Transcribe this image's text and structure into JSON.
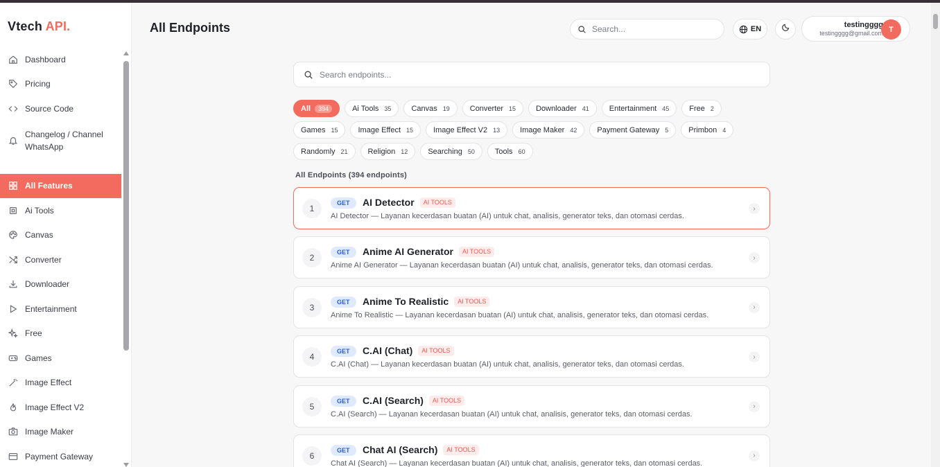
{
  "brand": {
    "part1": "Vtech",
    "part2": "API."
  },
  "sidebar": {
    "top_items": [
      {
        "label": "Dashboard",
        "icon": "home-icon"
      },
      {
        "label": "Pricing",
        "icon": "tag-icon"
      },
      {
        "label": "Source Code",
        "icon": "code-icon"
      },
      {
        "label": "Changelog / Channel WhatsApp",
        "icon": "bell-icon"
      }
    ],
    "feature_items": [
      {
        "label": "All Features",
        "icon": "grid-icon",
        "active": true
      },
      {
        "label": "Ai Tools",
        "icon": "chip-icon"
      },
      {
        "label": "Canvas",
        "icon": "palette-icon"
      },
      {
        "label": "Converter",
        "icon": "shuffle-icon"
      },
      {
        "label": "Downloader",
        "icon": "download-icon"
      },
      {
        "label": "Entertainment",
        "icon": "play-icon"
      },
      {
        "label": "Free",
        "icon": "sparkle-icon"
      },
      {
        "label": "Games",
        "icon": "gamepad-icon"
      },
      {
        "label": "Image Effect",
        "icon": "wand-icon"
      },
      {
        "label": "Image Effect V2",
        "icon": "flame-icon"
      },
      {
        "label": "Image Maker",
        "icon": "camera-icon"
      },
      {
        "label": "Payment Gateway",
        "icon": "card-icon"
      }
    ]
  },
  "header": {
    "title": "All Endpoints",
    "search_placeholder": "Search...",
    "lang": "EN",
    "user_name": "testingggg",
    "user_email": "testingggg@gmail.com",
    "avatar_letter": "T"
  },
  "main": {
    "search_placeholder": "Search endpoints...",
    "list_title": "All Endpoints (394 endpoints)",
    "chip_rows": [
      [
        {
          "label": "All",
          "count": "394",
          "active": true
        },
        {
          "label": "Ai Tools",
          "count": "35"
        },
        {
          "label": "Canvas",
          "count": "19"
        },
        {
          "label": "Converter",
          "count": "15"
        },
        {
          "label": "Downloader",
          "count": "41"
        },
        {
          "label": "Entertainment",
          "count": "45"
        },
        {
          "label": "Free",
          "count": "2"
        }
      ],
      [
        {
          "label": "Games",
          "count": "15"
        },
        {
          "label": "Image Effect",
          "count": "15"
        },
        {
          "label": "Image Effect V2",
          "count": "13"
        },
        {
          "label": "Image Maker",
          "count": "42"
        },
        {
          "label": "Payment Gateway",
          "count": "5"
        },
        {
          "label": "Primbon",
          "count": "4"
        }
      ],
      [
        {
          "label": "Randomly",
          "count": "21"
        },
        {
          "label": "Religion",
          "count": "12"
        },
        {
          "label": "Searching",
          "count": "50"
        },
        {
          "label": "Tools",
          "count": "60"
        }
      ]
    ],
    "endpoints": [
      {
        "num": "1",
        "method": "GET",
        "name": "AI Detector",
        "tag": "AI TOOLS",
        "desc": "AI Detector — Layanan kecerdasan buatan (AI) untuk chat, analisis, generator teks, dan otomasi cerdas.",
        "active": true
      },
      {
        "num": "2",
        "method": "GET",
        "name": "Anime AI Generator",
        "tag": "AI TOOLS",
        "desc": "Anime AI Generator — Layanan kecerdasan buatan (AI) untuk chat, analisis, generator teks, dan otomasi cerdas."
      },
      {
        "num": "3",
        "method": "GET",
        "name": "Anime To Realistic",
        "tag": "AI TOOLS",
        "desc": "Anime To Realistic — Layanan kecerdasan buatan (AI) untuk chat, analisis, generator teks, dan otomasi cerdas."
      },
      {
        "num": "4",
        "method": "GET",
        "name": "C.AI (Chat)",
        "tag": "AI TOOLS",
        "desc": "C.AI (Chat) — Layanan kecerdasan buatan (AI) untuk chat, analisis, generator teks, dan otomasi cerdas."
      },
      {
        "num": "5",
        "method": "GET",
        "name": "C.AI (Search)",
        "tag": "AI TOOLS",
        "desc": "C.AI (Search) — Layanan kecerdasan buatan (AI) untuk chat, analisis, generator teks, dan otomasi cerdas."
      },
      {
        "num": "6",
        "method": "GET",
        "name": "Chat AI (Search)",
        "tag": "AI TOOLS",
        "desc": "Chat AI (Search) — Layanan kecerdasan buatan (AI) untuk chat, analisis, generator teks, dan otomasi cerdas."
      }
    ]
  }
}
